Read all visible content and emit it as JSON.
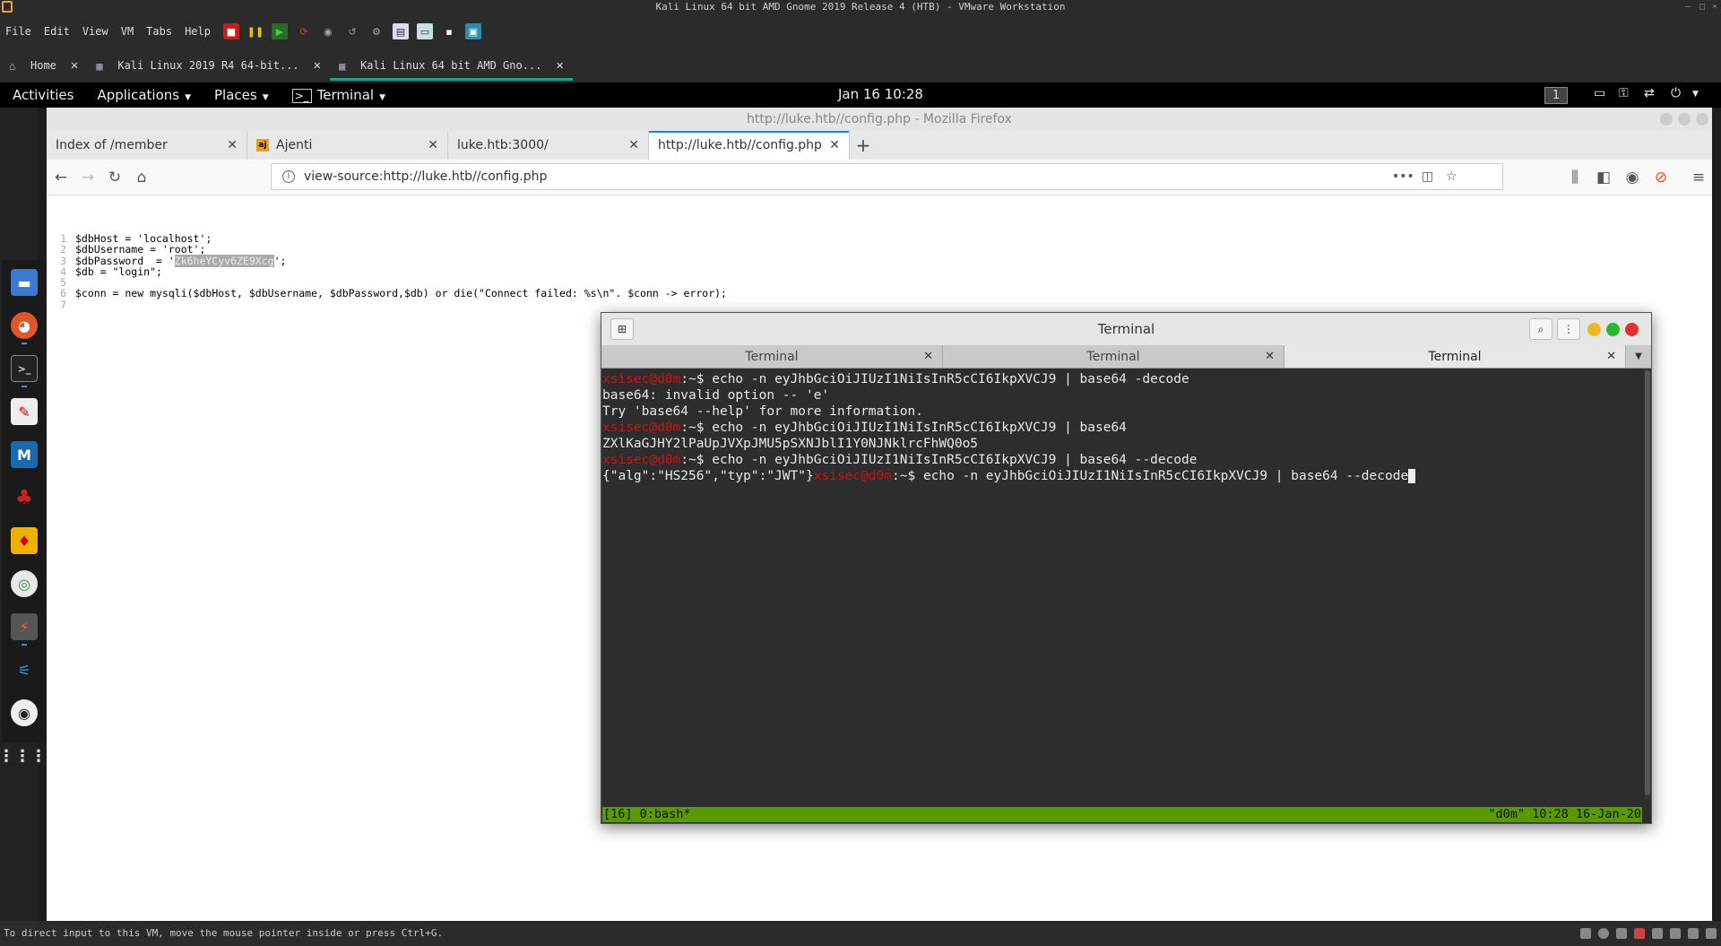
{
  "vmware": {
    "title": "Kali Linux 64 bit AMD Gnome 2019 Release 4 (HTB) - VMware Workstation",
    "menu": [
      "File",
      "Edit",
      "View",
      "VM",
      "Tabs",
      "Help"
    ],
    "tabs": [
      {
        "label": "Home",
        "icon": "home-icon"
      },
      {
        "label": "Kali Linux 2019 R4 64-bit...",
        "icon": "vm-icon"
      },
      {
        "label": "Kali Linux 64 bit AMD Gno...",
        "icon": "vm-icon",
        "active": true
      }
    ],
    "status_text": "To direct input to this VM, move the mouse pointer inside or press Ctrl+G."
  },
  "gnome": {
    "activities": "Activities",
    "applications": "Applications",
    "places": "Places",
    "terminal": "Terminal",
    "clock": "Jan 16  10:28",
    "workspace": "1"
  },
  "dock": {
    "items": [
      "files-icon",
      "firefox-icon",
      "terminal-icon",
      "text-editor-icon",
      "metasploit-icon",
      "cherrytree-icon",
      "burp-icon",
      "chrome-icon",
      "burpsuite-icon",
      "tweaks-icon",
      "disc-icon",
      "app-grid-icon"
    ]
  },
  "firefox": {
    "title": "http://luke.htb//config.php - Mozilla Firefox",
    "tabs": [
      {
        "label": "Index of /member"
      },
      {
        "label": "Ajenti",
        "favicon": "aj"
      },
      {
        "label": "luke.htb:3000/"
      },
      {
        "label": "http://luke.htb//config.php",
        "active": true
      }
    ],
    "url": "view-source:http://luke.htb//config.php",
    "source_lines": [
      {
        "n": "1",
        "pre": "$dbHost = 'localhost';",
        "sel": "",
        "post": ""
      },
      {
        "n": "2",
        "pre": "$dbUsername = 'root';",
        "sel": "",
        "post": ""
      },
      {
        "n": "3",
        "pre": "$dbPassword  = '",
        "sel": "Zk6heYCyv6ZE9Xcg",
        "post": "';"
      },
      {
        "n": "4",
        "pre": "$db = \"login\";",
        "sel": "",
        "post": ""
      },
      {
        "n": "5",
        "pre": "",
        "sel": "",
        "post": ""
      },
      {
        "n": "6",
        "pre": "$conn = new mysqli($dbHost, $dbUsername, $dbPassword,$db) or die(\"Connect failed: %s\\n\". $conn -> error);",
        "sel": "",
        "post": ""
      },
      {
        "n": "7",
        "pre": "",
        "sel": "",
        "post": ""
      }
    ]
  },
  "terminal": {
    "title": "Terminal",
    "tabs": [
      {
        "label": "Terminal"
      },
      {
        "label": "Terminal"
      },
      {
        "label": "Terminal",
        "active": true
      }
    ],
    "prompt_user": "xsisec@d0m",
    "prompt_sep": ":~$ ",
    "lines": [
      {
        "prompt": true,
        "text": "echo -n eyJhbGciOiJIUzI1NiIsInR5cCI6IkpXVCJ9 | base64 -decode"
      },
      {
        "prompt": false,
        "text": "base64: invalid option -- 'e'"
      },
      {
        "prompt": false,
        "text": "Try 'base64 --help' for more information."
      },
      {
        "prompt": true,
        "text": "echo -n eyJhbGciOiJIUzI1NiIsInR5cCI6IkpXVCJ9 | base64"
      },
      {
        "prompt": false,
        "text": "ZXlKaGJHY2lPaUpJVXpJMU5pSXNJblI1Y0NJNklrcFhWQ0o5"
      },
      {
        "prompt": true,
        "text": "echo -n eyJhbGciOiJIUzI1NiIsInR5cCI6IkpXVCJ9 | base64 --decode"
      }
    ],
    "last_output": "{\"alg\":\"HS256\",\"typ\":\"JWT\"}",
    "last_command": "echo -n eyJhbGciOiJIUzI1NiIsInR5cCI6IkpXVCJ9 | base64 --decode",
    "tmux_left": "[16] 0:bash*",
    "tmux_right": "\"d0m\" 10:28 16-Jan-20"
  },
  "colors": {
    "prompt": "#d01010",
    "tmux_bar": "#5a9a00",
    "ff_tab_accent": "#0a84ff",
    "vm_tab_accent": "#1aa58a"
  }
}
